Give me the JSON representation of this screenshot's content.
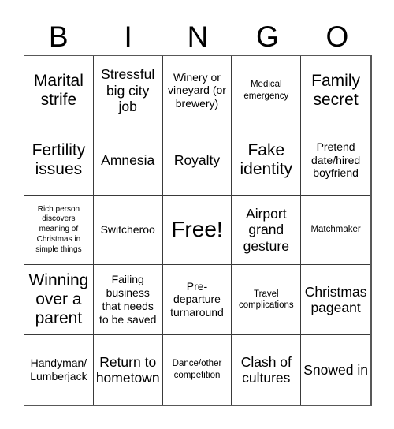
{
  "card": {
    "title": "BINGO",
    "header_letters": [
      "B",
      "I",
      "N",
      "G",
      "O"
    ],
    "columns": 5,
    "rows": 5,
    "border_color": "#3a3a3a",
    "background_color": "#ffffff",
    "text_color": "#000000",
    "free_space_index": 12,
    "cells": [
      {
        "text": "Marital strife",
        "size": "lg",
        "marked": false
      },
      {
        "text": "Stressful big city job",
        "size": "md",
        "marked": false
      },
      {
        "text": "Winery or vineyard (or brewery)",
        "size": "sm",
        "marked": false
      },
      {
        "text": "Medical emergency",
        "size": "xs",
        "marked": false
      },
      {
        "text": "Family secret",
        "size": "lg",
        "marked": false
      },
      {
        "text": "Fertility issues",
        "size": "lg",
        "marked": false
      },
      {
        "text": "Amnesia",
        "size": "md",
        "marked": false
      },
      {
        "text": "Royalty",
        "size": "md",
        "marked": false
      },
      {
        "text": "Fake identity",
        "size": "lg",
        "marked": false
      },
      {
        "text": "Pretend date/hired boyfriend",
        "size": "sm",
        "marked": false
      },
      {
        "text": "Rich person discovers meaning of Christmas in simple things",
        "size": "xxs",
        "marked": false
      },
      {
        "text": "Switcheroo",
        "size": "sm",
        "marked": false
      },
      {
        "text": "Free!",
        "size": "xl",
        "marked": false
      },
      {
        "text": "Airport grand gesture",
        "size": "md",
        "marked": false
      },
      {
        "text": "Matchmaker",
        "size": "xs",
        "marked": false
      },
      {
        "text": "Winning over a parent",
        "size": "lg",
        "marked": false
      },
      {
        "text": "Failing business that needs to be saved",
        "size": "sm",
        "marked": false
      },
      {
        "text": "Pre-departure turnaround",
        "size": "sm",
        "marked": false
      },
      {
        "text": "Travel complications",
        "size": "xs",
        "marked": false
      },
      {
        "text": "Christmas pageant",
        "size": "md",
        "marked": false
      },
      {
        "text": "Handyman/ Lumberjack",
        "size": "sm",
        "marked": false
      },
      {
        "text": "Return to hometown",
        "size": "md",
        "marked": false
      },
      {
        "text": "Dance/other competition",
        "size": "xs",
        "marked": false
      },
      {
        "text": "Clash of cultures",
        "size": "md",
        "marked": false
      },
      {
        "text": "Snowed in",
        "size": "md",
        "marked": false
      }
    ]
  }
}
